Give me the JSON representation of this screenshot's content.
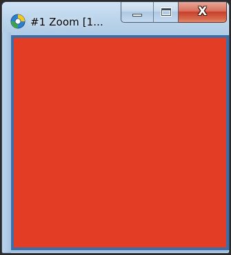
{
  "window": {
    "title": "#1 Zoom [1...",
    "icon": "app-logo-icon",
    "controls": {
      "minimize_icon": "minimize-icon",
      "maximize_icon": "maximize-icon",
      "close_icon": "close-icon",
      "close_glyph": "X"
    }
  },
  "content": {
    "fill_color": "#e33d26",
    "frame_color": "#3d6ea8"
  }
}
